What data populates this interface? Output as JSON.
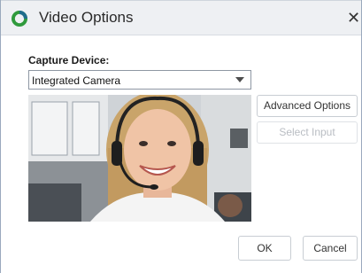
{
  "window": {
    "title": "Video Options",
    "close_symbol": "✕",
    "app_icon": "app-logo-icon"
  },
  "capture": {
    "label": "Capture Device:",
    "selected_device": "Integrated Camera"
  },
  "preview": {
    "description_icon": "camera-preview-image"
  },
  "buttons": {
    "advanced_options": "Advanced Options",
    "select_input": "Select Input",
    "ok": "OK",
    "cancel": "Cancel"
  },
  "colors": {
    "accent_green": "#2f9a3c",
    "disabled_text": "#b9bdc3"
  }
}
